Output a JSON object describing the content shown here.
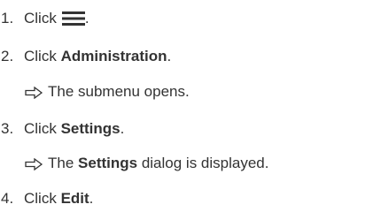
{
  "steps": [
    {
      "num": "1.",
      "pre": "Click",
      "icon": "hamburger-menu-icon",
      "post": "."
    },
    {
      "num": "2.",
      "pre": "Click ",
      "bold": "Administration",
      "post": ".",
      "result": {
        "text": "The submenu opens."
      }
    },
    {
      "num": "3.",
      "pre": "Click ",
      "bold": "Settings",
      "post": ".",
      "result": {
        "pre": "The ",
        "bold": "Settings",
        "post": " dialog is displayed."
      }
    },
    {
      "num": "4.",
      "pre": "Click ",
      "bold": "Edit",
      "post": "."
    }
  ]
}
